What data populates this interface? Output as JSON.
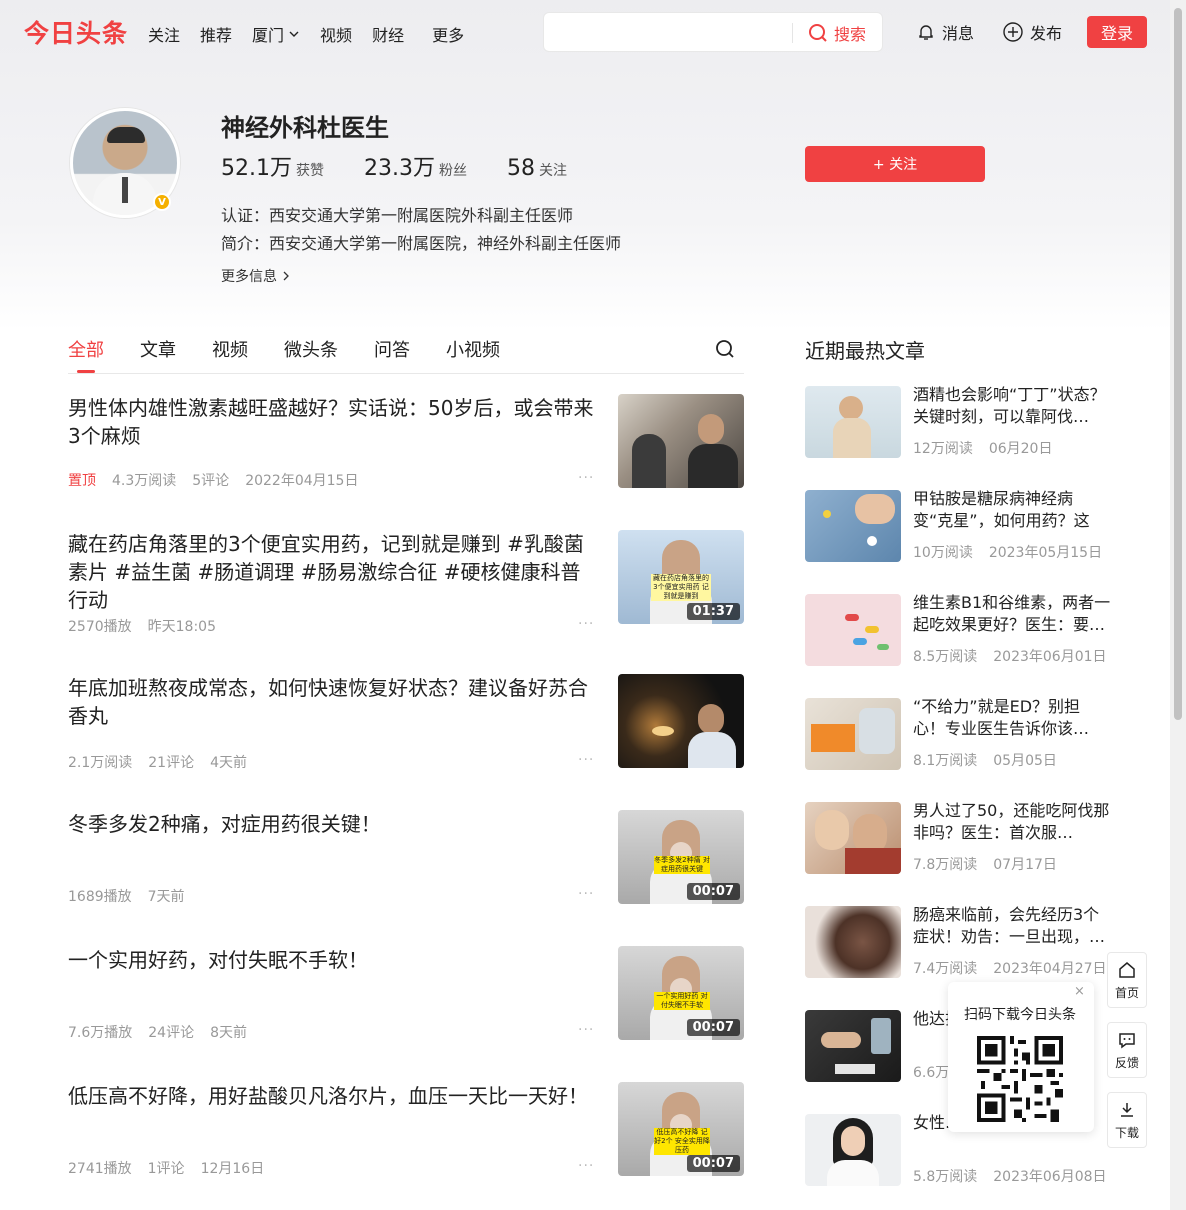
{
  "header": {
    "logo": "今日头条",
    "nav": [
      "关注",
      "推荐",
      "厦门",
      "视频",
      "财经"
    ],
    "nav_more": "更多",
    "search_placeholder": "",
    "search_button": "搜索",
    "messages": "消息",
    "publish": "发布",
    "login": "登录"
  },
  "profile": {
    "name": "神经外科杜医生",
    "likes_num": "52.1万",
    "likes_label": "获赞",
    "fans_num": "23.3万",
    "fans_label": "粉丝",
    "following_num": "58",
    "following_label": "关注",
    "certification": "认证：西安交通大学第一附属医院外科副主任医师",
    "intro": "简介：西安交通大学第一附属医院，神经外科副主任医师",
    "more_info": "更多信息",
    "follow_button": "+ 关注",
    "verified_badge": "V"
  },
  "tabs": [
    "全部",
    "文章",
    "视频",
    "微头条",
    "问答",
    "小视频"
  ],
  "feed": [
    {
      "title": "男性体内雄性激素越旺盛越好？实话说：50岁后，或会带来3个麻烦",
      "pin": "置顶",
      "meta": [
        "4.3万阅读",
        "5评论",
        "2022年04月15日"
      ],
      "duration": ""
    },
    {
      "title": "藏在药店角落里的3个便宜实用药，记到就是赚到 #乳酸菌素片 #益生菌 #肠道调理 #肠易激综合征 #硬核健康科普行动",
      "pin": "",
      "meta": [
        "2570播放",
        "昨天18:05"
      ],
      "duration": "01:37",
      "caption": "藏在药店角落里的3个便宜实用药 记到就是赚到"
    },
    {
      "title": "年底加班熬夜成常态，如何快速恢复好状态？建议备好苏合香丸",
      "pin": "",
      "meta": [
        "2.1万阅读",
        "21评论",
        "4天前"
      ],
      "duration": ""
    },
    {
      "title": "冬季多发2种痛，对症用药很关键！",
      "pin": "",
      "meta": [
        "1689播放",
        "7天前"
      ],
      "duration": "00:07",
      "caption": "冬季多发2种痛 对症用药很关键"
    },
    {
      "title": "一个实用好药，对付失眠不手软！",
      "pin": "",
      "meta": [
        "7.6万播放",
        "24评论",
        "8天前"
      ],
      "duration": "00:07",
      "caption": "一个实用好药 对付失眠不手软"
    },
    {
      "title": "低压高不好降，用好盐酸贝凡洛尔片，血压一天比一天好！",
      "pin": "",
      "meta": [
        "2741播放",
        "1评论",
        "12月16日"
      ],
      "duration": "00:07",
      "caption": "低压高不好降 记好2个 安全实用降压药"
    }
  ],
  "side": {
    "title": "近期最热文章",
    "items": [
      {
        "title": "酒精也会影响“丁丁”状态？关键时刻，可以靠阿伐…",
        "reads": "12万阅读",
        "date": "06月20日"
      },
      {
        "title": "甲钴胺是糖尿病神经病变“克星”，如何用药？这5…",
        "reads": "10万阅读",
        "date": "2023年05月15日"
      },
      {
        "title": "维生素B1和谷维素，两者一起吃效果更好？医生：要…",
        "reads": "8.5万阅读",
        "date": "2023年06月01日"
      },
      {
        "title": "“不给力”就是ED？别担心！专业医生告诉你该…",
        "reads": "8.1万阅读",
        "date": "05月05日"
      },
      {
        "title": "男人过了50，还能吃阿伐那非吗？医生：首次服…",
        "reads": "7.8万阅读",
        "date": "07月17日"
      },
      {
        "title": "肠癌来临前，会先经历3个症状！劝告：一旦出现，…",
        "reads": "7.4万阅读",
        "date": "2023年04月27日"
      },
      {
        "title": "他达拉非起…",
        "reads": "6.6万阅读",
        "date": ""
      },
      {
        "title": "女性…得什么病？…",
        "reads": "5.8万阅读",
        "date": "2023年06月08日"
      }
    ]
  },
  "float": {
    "qr_title": "扫码下载今日头条",
    "close": "×",
    "home": "首页",
    "feedback": "反馈",
    "download": "下载"
  },
  "colors": {
    "accent": "#f04142",
    "meta": "#999999"
  }
}
